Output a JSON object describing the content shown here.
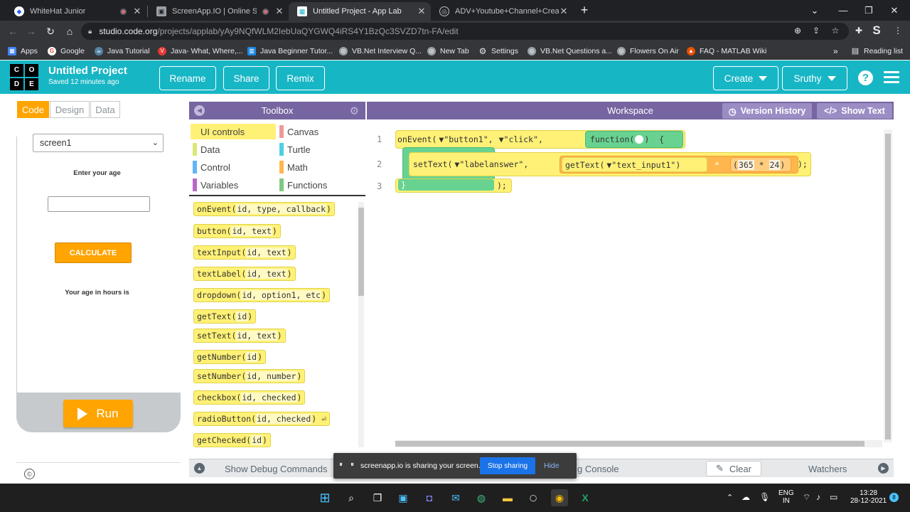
{
  "browser": {
    "tabs": [
      {
        "title": "WhiteHat Junior",
        "active": false,
        "recording": true
      },
      {
        "title": "ScreenApp.IO | Online Screen",
        "active": false,
        "recording": true
      },
      {
        "title": "Untitled Project - App Lab",
        "active": true,
        "recording": false
      },
      {
        "title": "ADV+Youtube+Channel+Creatio",
        "active": false,
        "recording": false
      }
    ],
    "new_tab": "+",
    "url_host": "studio.code.org",
    "url_path": "/projects/applab/yAy9NQfWLM2IebUaQYGWQ4iRS4Y1BzQc3SVZD7tn-FA/edit",
    "profile_initial": "S",
    "bookmarks": [
      {
        "label": "Apps",
        "icon": "apps-grid-icon",
        "color": "#4285f4"
      },
      {
        "label": "Google",
        "icon": "google-icon",
        "color": "#ea4335"
      },
      {
        "label": "Java Tutorial",
        "icon": "java-icon",
        "color": "#5382a1"
      },
      {
        "label": "Java- What, Where,...",
        "icon": "v-icon",
        "color": "#e53935"
      },
      {
        "label": "Java Beginner Tutor...",
        "icon": "building-icon",
        "color": "#1e88e5"
      },
      {
        "label": "VB.Net Interview Q...",
        "icon": "globe-icon",
        "color": "#9aa0a6"
      },
      {
        "label": "New Tab",
        "icon": "globe-icon",
        "color": "#9aa0a6"
      },
      {
        "label": "Settings",
        "icon": "gear-icon",
        "color": "#9aa0a6"
      },
      {
        "label": "VB.Net Questions a...",
        "icon": "globe-icon",
        "color": "#9aa0a6"
      },
      {
        "label": "Flowers On Air",
        "icon": "globe-icon",
        "color": "#9aa0a6"
      },
      {
        "label": "FAQ - MATLAB Wiki",
        "icon": "matlab-icon",
        "color": "#e65100"
      }
    ],
    "more_bookmarks": "»",
    "reading_list": "Reading list"
  },
  "app": {
    "logo_letters": [
      "C",
      "O",
      "D",
      "E"
    ],
    "project_title": "Untitled Project",
    "saved_status": "Saved 12 minutes ago",
    "rename": "Rename",
    "share": "Share",
    "remix": "Remix",
    "create": "Create",
    "user": "Sruthy",
    "help": "?",
    "accent": "#17b6c5"
  },
  "left": {
    "modes": [
      "Code",
      "Design",
      "Data"
    ],
    "active_mode": "Code",
    "screen_select": "screen1",
    "app_preview": {
      "age_label": "Enter your age",
      "age_input_value": "",
      "calculate_button": "CALCULATE",
      "result_label": "Your age in hours is"
    },
    "run": "Run",
    "copyright": "©"
  },
  "toolbox": {
    "title": "Toolbox",
    "categories": [
      {
        "label": "UI controls",
        "color": "#fff176",
        "selected": true
      },
      {
        "label": "Canvas",
        "color": "#ef9a9a",
        "selected": false
      },
      {
        "label": "Data",
        "color": "#dce775",
        "selected": false
      },
      {
        "label": "Turtle",
        "color": "#4dd0e1",
        "selected": false
      },
      {
        "label": "Control",
        "color": "#64b5f6",
        "selected": false
      },
      {
        "label": "Math",
        "color": "#ffb74d",
        "selected": false
      },
      {
        "label": "Variables",
        "color": "#ba68c8",
        "selected": false
      },
      {
        "label": "Functions",
        "color": "#81c784",
        "selected": false
      }
    ],
    "blocks": [
      {
        "name": "onEvent",
        "args": "id, type, callback"
      },
      {
        "name": "button",
        "args": "id, text"
      },
      {
        "name": "textInput",
        "args": "id, text"
      },
      {
        "name": "textLabel",
        "args": "id, text"
      },
      {
        "name": "dropdown",
        "args": "id, option1, etc"
      },
      {
        "name": "getText",
        "args": "id"
      },
      {
        "name": "setText",
        "args": "id, text"
      },
      {
        "name": "getNumber",
        "args": "id"
      },
      {
        "name": "setNumber",
        "args": "id, number"
      },
      {
        "name": "checkbox",
        "args": "id, checked"
      },
      {
        "name": "radioButton",
        "args": "id, checked"
      },
      {
        "name": "getChecked",
        "args": "id"
      }
    ]
  },
  "workspace": {
    "title": "Workspace",
    "version_history": "Version History",
    "show_text": "Show Text",
    "line_numbers": [
      "1",
      "2",
      "3"
    ],
    "code": {
      "l1_fn": "onEvent",
      "l1_arg1": "\"button1\"",
      "l1_arg2": "\"click\"",
      "l1_func": "function",
      "l2_fn": "setText",
      "l2_arg1": "\"labelanswer\"",
      "l2_gettext": "getText",
      "l2_gettext_arg": "\"text_input1\"",
      "l2_times": "*",
      "l2_n1": "365",
      "l2_n2": "24",
      "l3_end": ");"
    }
  },
  "debug": {
    "show_debug": "Show Debug Commands",
    "console": "g Console",
    "clear": "Clear",
    "watchers": "Watchers"
  },
  "share_overlay": {
    "message": "screenapp.io is sharing your screen.",
    "stop": "Stop sharing",
    "hide": "Hide"
  },
  "taskbar": {
    "lang": "ENG",
    "region": "IN",
    "time": "13:28",
    "date": "28-12-2021",
    "notifications": "8"
  }
}
